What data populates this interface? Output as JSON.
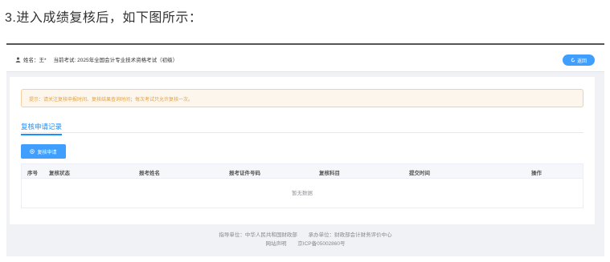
{
  "caption": "3.进入成绩复核后，如下图所示：",
  "header": {
    "user_label": "姓名：王*",
    "exam_label": "当前考试: 2025年全国会计专业技术资格考试（初级）",
    "back_label": "返回"
  },
  "notice": {
    "text": "提示：请关注复核申报时间、复核结果查询时间；每次考试只允许复核一次。"
  },
  "tabs": [
    {
      "label": "复核申请记录"
    }
  ],
  "actions": {
    "apply_label": "复核申请"
  },
  "table": {
    "columns": [
      "序号",
      "复核状态",
      "报考姓名",
      "报考证件号码",
      "复核科目",
      "提交时间",
      "操作"
    ],
    "empty_text": "暂无数据"
  },
  "footer": {
    "guide": "指导单位：中华人民共和国财政部",
    "organizer": "承办单位：财政部会计财务评价中心",
    "site_statement": "网站声明",
    "icp": "京ICP备05002860号"
  },
  "colors": {
    "primary": "#409eff",
    "warning_text": "#e6a23c",
    "warning_bg": "#fdf6ec",
    "page_bg": "#f0f2f5"
  },
  "icons": [
    "user-icon",
    "refresh-icon",
    "plus-circle-icon"
  ]
}
